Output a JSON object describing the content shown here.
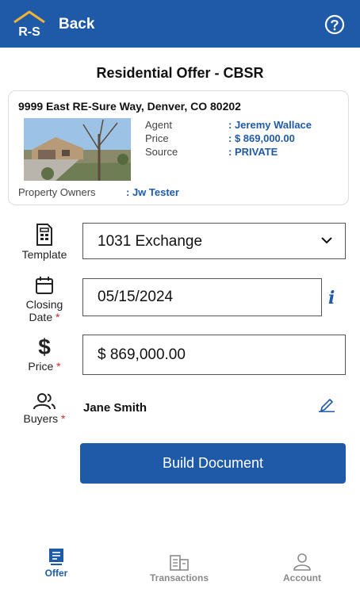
{
  "header": {
    "logo_text": "R-S",
    "back_label": "Back"
  },
  "title": "Residential Offer - CBSR",
  "property": {
    "address": "9999 East RE-Sure Way, Denver, CO 80202",
    "agent_label": "Agent",
    "agent_value": ": Jeremy  Wallace",
    "price_label": "Price",
    "price_value": ": $ 869,000.00",
    "source_label": "Source",
    "source_value": ": PRIVATE",
    "owners_label": "Property Owners",
    "owners_value": ": Jw  Tester"
  },
  "form": {
    "template_label": "Template",
    "template_value": "1031 Exchange",
    "closing_label_1": "Closing",
    "closing_label_2": "Date",
    "closing_value": "05/15/2024",
    "info_glyph": "i",
    "price_label": "Price",
    "price_value": "$ 869,000.00",
    "buyers_label": "Buyers",
    "buyers_value": "Jane Smith",
    "required_mark": "*"
  },
  "build_button": "Build Document",
  "nav": {
    "offer": "Offer",
    "transactions": "Transactions",
    "account": "Account"
  },
  "colors": {
    "brand": "#1f5aa8",
    "required": "#d0282f",
    "inactive": "#8a8a8a"
  }
}
